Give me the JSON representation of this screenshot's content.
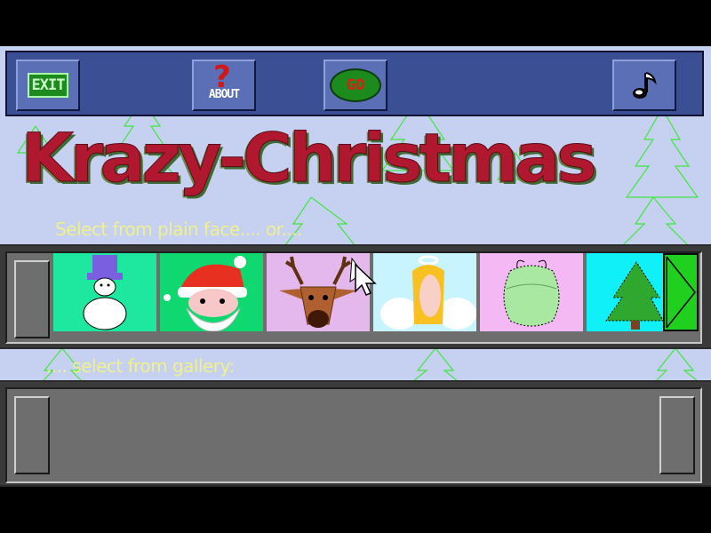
{
  "toolbar": {
    "exit_label": "EXIT",
    "about_label": "ABOUT",
    "about_mark": "?",
    "go_label": "GO",
    "music_icon": "music-note-icon"
  },
  "title": "Krazy-Christmas",
  "prompts": {
    "plain_face": "Select from plain face.... or....",
    "gallery": ".... select from gallery:"
  },
  "faces": [
    {
      "name": "snowman",
      "bg": "#1ee8a0"
    },
    {
      "name": "santa",
      "bg": "#10d870"
    },
    {
      "name": "reindeer",
      "bg": "#e4b8ec"
    },
    {
      "name": "angel",
      "bg": "#c8f4ff"
    },
    {
      "name": "grinch",
      "bg": "#f4b8f4"
    },
    {
      "name": "christmas-tree",
      "bg": "#10f0f8"
    }
  ],
  "colors": {
    "background": "#c6d0f0",
    "toolbar": "#3a4f94",
    "title_red": "#b01830",
    "title_green": "#3f6a35",
    "prompt_text": "#f0f08c"
  }
}
